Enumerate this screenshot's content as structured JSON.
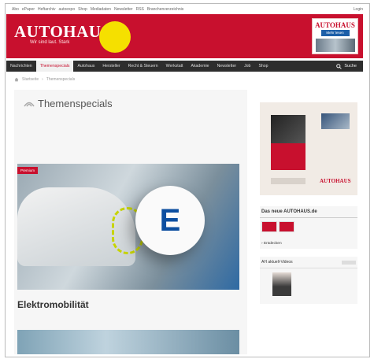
{
  "meta_bar": {
    "links": [
      "Abo",
      "ePaper",
      "Heftarchiv",
      "autoexpo",
      "Shop",
      "Mediadaten",
      "Newsletter",
      "RSS",
      "Branchenverzeichnis"
    ],
    "login": "Login"
  },
  "header": {
    "logo": "AUTOHAUS",
    "tagline": "Wir sind laut. Stark",
    "badge_text": "",
    "promo_text": "",
    "promo_box_title": "AUTOHAUS",
    "promo_box_button": "Mehr lesen"
  },
  "nav": {
    "items": [
      "Nachrichten",
      "Themenspecials",
      "Autohaus",
      "Hersteller",
      "Recht & Steuern",
      "Werkstatt",
      "Akademie",
      "Newsletter",
      "Job",
      "Shop"
    ],
    "active_index": 1,
    "search_label": "Suche"
  },
  "breadcrumb": {
    "home": "Startseite",
    "current": "Themenspecials"
  },
  "main": {
    "title": "Themenspecials",
    "intro": "",
    "hero_badge": "Premium",
    "article_title": "Elektromobilität"
  },
  "sidebar": {
    "ad_label": "AUTOHAUS",
    "section_title": "Das neue AUTOHAUS.de",
    "mag_text": "",
    "description": "",
    "link": "Entdecken",
    "section2_title": "AH aktuell-Videos",
    "portrait_text": ""
  },
  "colors": {
    "brand_red": "#c8102e",
    "nav_dark": "#2d2d2d",
    "badge_yellow": "#f5e000",
    "link_blue": "#1d5fa8"
  }
}
